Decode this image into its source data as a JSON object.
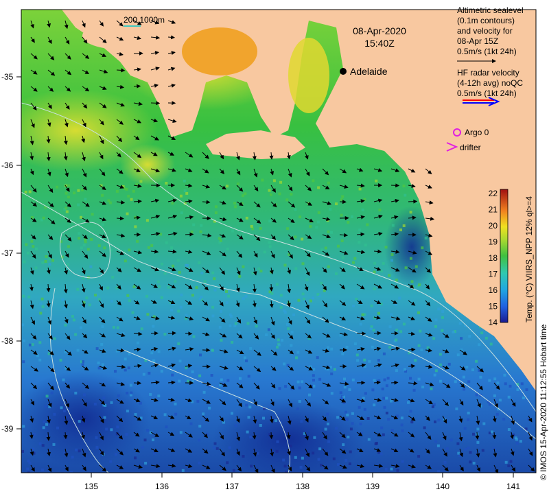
{
  "map": {
    "title_date": "08-Apr-2020",
    "title_time": "15:40Z",
    "depth_contours_label": "200  1000m",
    "city_label": "Adelaide",
    "altimetric_lines": [
      "Altimetric sealevel",
      "(0.1m contours)",
      "and velocity for",
      "08-Apr 15Z",
      "0.5m/s (1kt 24h)"
    ],
    "hf_radar_lines": [
      "HF radar velocity",
      "(4-12h avg) noQC",
      "0.5m/s (1kt 24h)"
    ],
    "argo_label": "Argo 0",
    "drifter_label": "drifter",
    "credit": "© IMOS 15-Apr-2020 11:12:55 Hobart time",
    "x_ticks": [
      "135",
      "136",
      "137",
      "138",
      "139",
      "140",
      "141"
    ],
    "y_ticks": [
      "-35",
      "-36",
      "-37",
      "-38",
      "-39"
    ],
    "colorbar": {
      "title": "Temp. (°C) VIIRS_NPP 12% ql>=4",
      "ticks": [
        "22",
        "21",
        "20",
        "19",
        "18",
        "17",
        "16",
        "15",
        "14"
      ],
      "min": 14,
      "max": 22
    },
    "colors": {
      "land": "#f8c8a0",
      "city_marker": "#000000",
      "argo": "#e020e0",
      "drifter": "#e020e0",
      "hf_red": "#ff0000",
      "hf_blue": "#0000ff",
      "contour_line": "#c8e0e0",
      "depth_scale": "#40c8c0"
    }
  }
}
